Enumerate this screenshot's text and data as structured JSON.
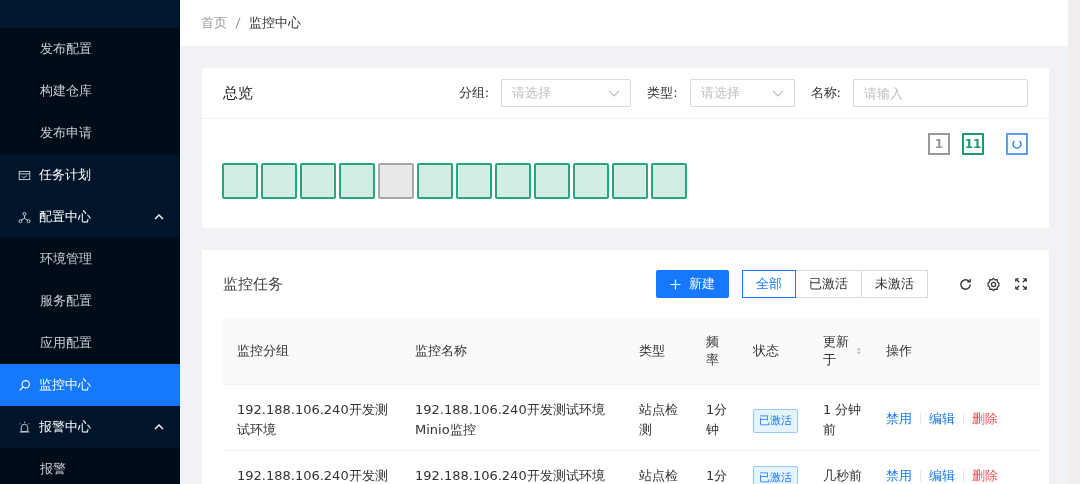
{
  "sidebar": {
    "items": [
      {
        "label": "发布配置",
        "kind": "sub",
        "selected": false
      },
      {
        "label": "构建仓库",
        "kind": "sub",
        "selected": false
      },
      {
        "label": "发布申请",
        "kind": "sub",
        "selected": false
      },
      {
        "label": "任务计划",
        "kind": "group",
        "selected": false
      },
      {
        "label": "配置中心",
        "kind": "group",
        "expanded": true,
        "selected": false
      },
      {
        "label": "环境管理",
        "kind": "sub",
        "selected": false
      },
      {
        "label": "服务配置",
        "kind": "sub",
        "selected": false
      },
      {
        "label": "应用配置",
        "kind": "sub",
        "selected": false
      },
      {
        "label": "监控中心",
        "kind": "group",
        "selected": true
      },
      {
        "label": "报警中心",
        "kind": "group",
        "expanded": true,
        "selected": false
      },
      {
        "label": "报警",
        "kind": "sub",
        "selected": false
      }
    ]
  },
  "breadcrumb": [
    "首页",
    "监控中心"
  ],
  "overview": {
    "title": "总览",
    "filters": [
      {
        "label": "分组:",
        "kind": "select",
        "placeholder": "请选择"
      },
      {
        "label": "类型:",
        "kind": "select",
        "placeholder": "请选择"
      },
      {
        "label": "名称:",
        "kind": "input",
        "placeholder": "请输入"
      }
    ],
    "counts": [
      {
        "value": "1",
        "color": "#999999"
      },
      {
        "value": "11",
        "color": "#1a9a72"
      }
    ],
    "nodes": [
      {
        "online": true
      },
      {
        "online": true
      },
      {
        "online": true
      },
      {
        "online": true
      },
      {
        "online": false
      },
      {
        "online": true
      },
      {
        "online": true
      },
      {
        "online": true
      },
      {
        "online": true
      },
      {
        "online": true
      },
      {
        "online": true
      },
      {
        "online": true
      }
    ]
  },
  "tasks": {
    "title": "监控任务",
    "new_button": "新建",
    "tabs": [
      {
        "label": "全部",
        "selected": true
      },
      {
        "label": "已激活",
        "selected": false
      },
      {
        "label": "未激活",
        "selected": false
      }
    ],
    "columns": [
      "监控分组",
      "监控名称",
      "类型",
      "频率",
      "状态",
      "更新于",
      "操作"
    ],
    "rows": [
      {
        "group": "192.188.106.240开发测试环境",
        "name": "192.188.106.240开发测试环境Minio监控",
        "type": "站点检测",
        "frequency": "1分钟",
        "status": "已激活",
        "active": true,
        "updated": "1 分钟前",
        "actions": [
          "禁用",
          "编辑",
          "删除"
        ]
      },
      {
        "group": "192.188.106.240开发测",
        "name": "192.188.106.240开发测试环境",
        "type": "站点检",
        "frequency": "1分",
        "status": "已激活",
        "active": true,
        "updated": "几秒前",
        "actions": [
          "禁用",
          "编辑",
          "删除"
        ]
      }
    ]
  }
}
